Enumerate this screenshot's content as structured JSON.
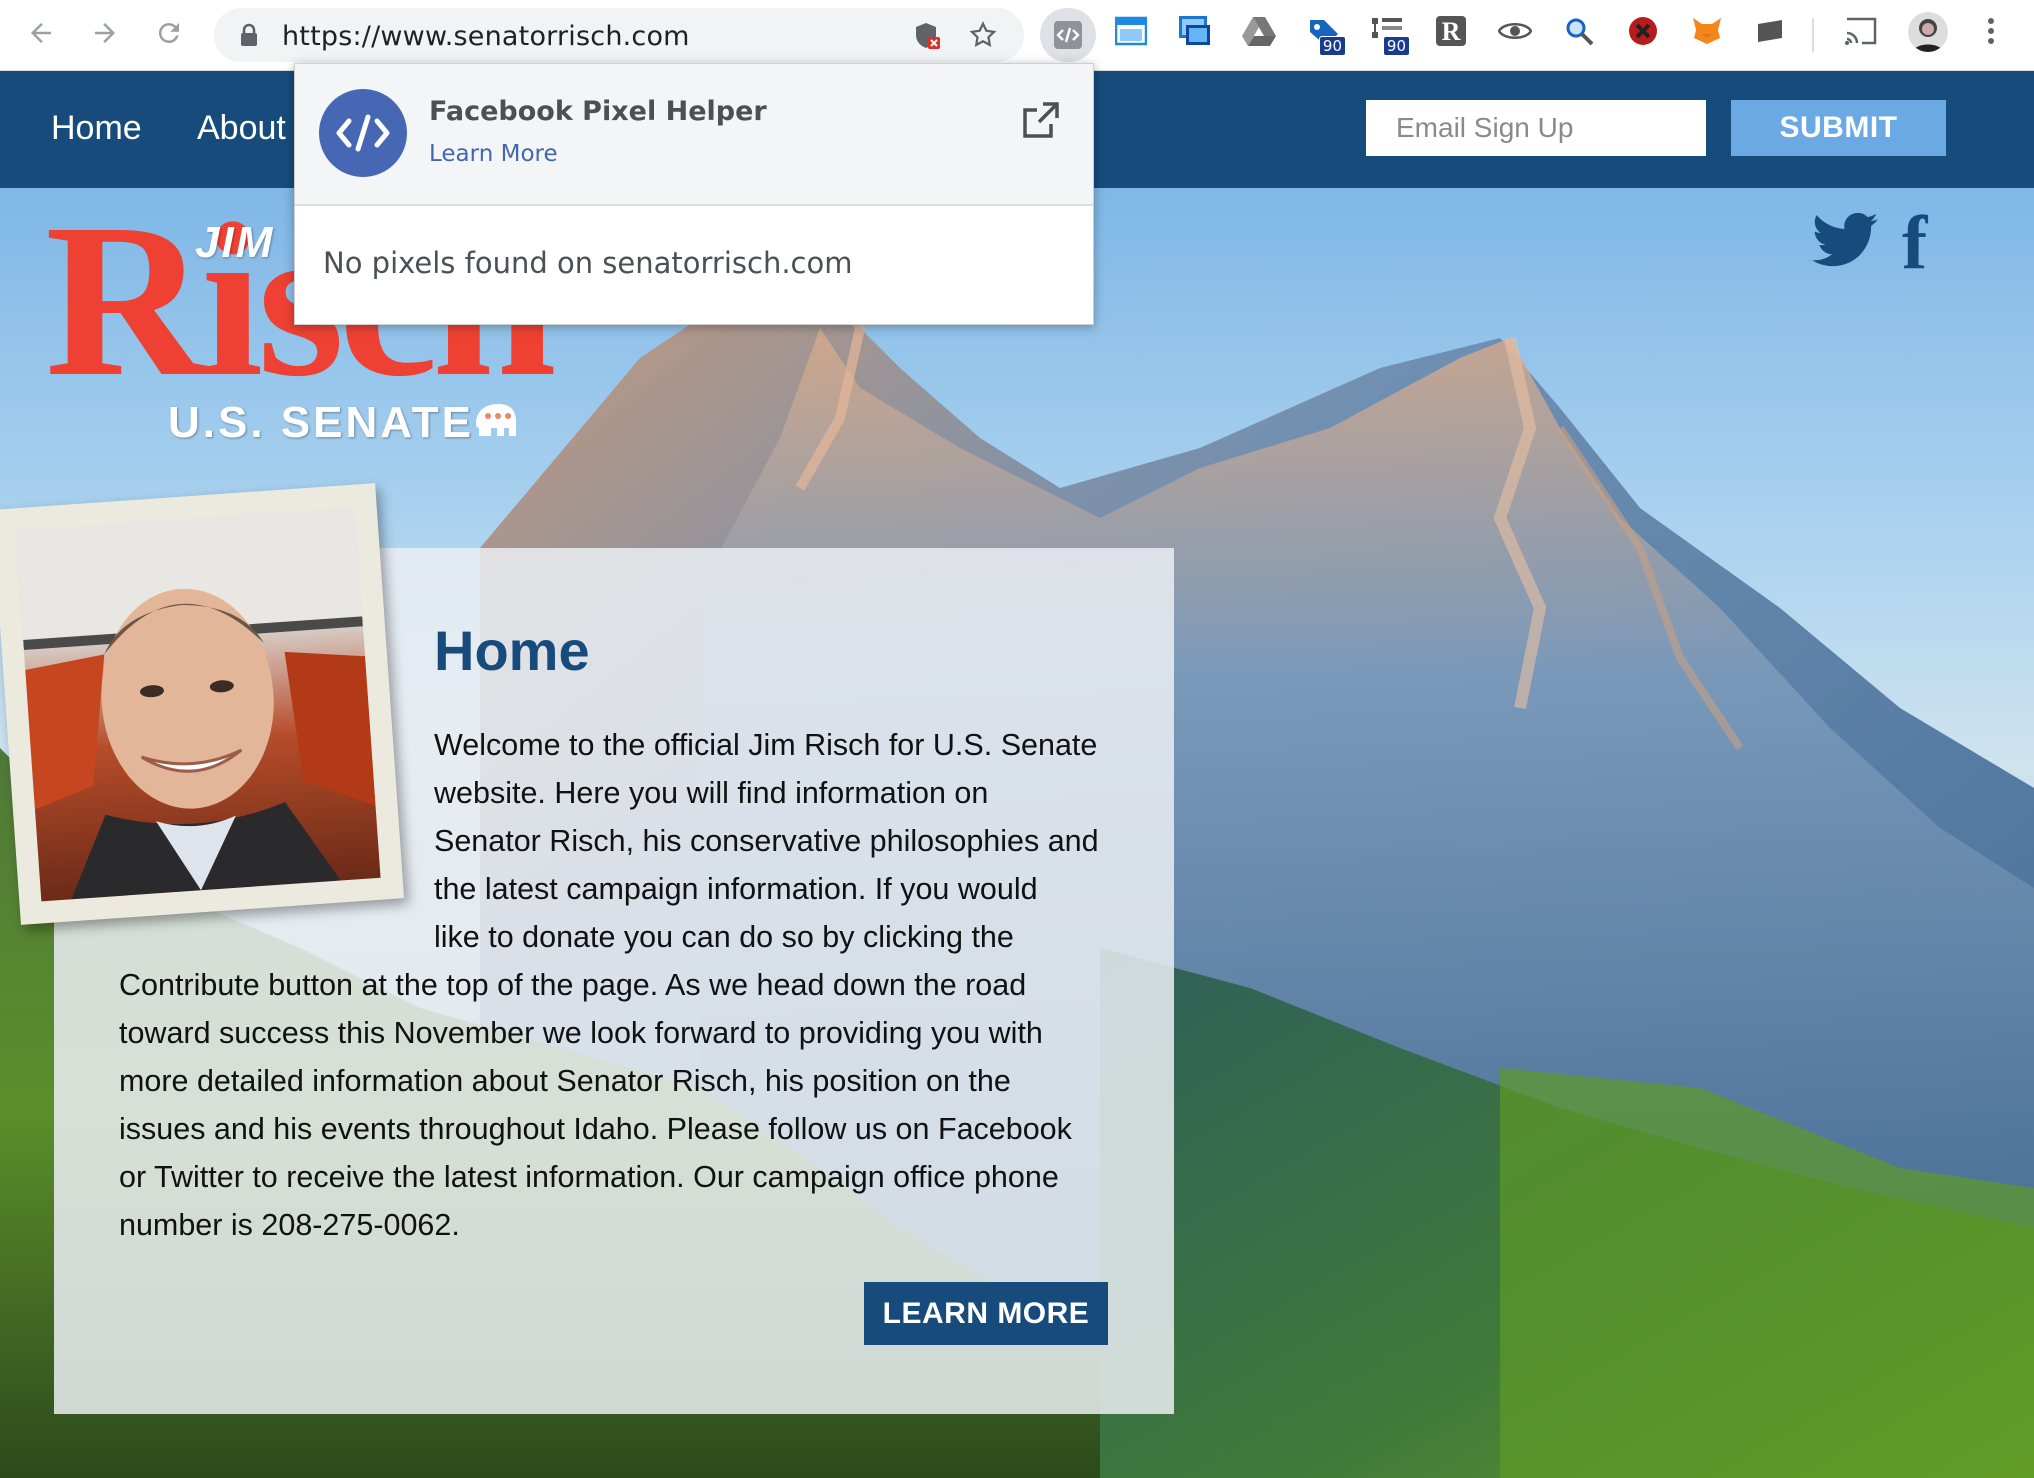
{
  "browser": {
    "url": "https://www.senatorrisch.com",
    "extensions": [
      {
        "name": "facebook-pixel-helper-icon"
      },
      {
        "name": "window-extension-icon"
      },
      {
        "name": "screenshot-extension-icon"
      },
      {
        "name": "drive-extension-icon"
      },
      {
        "name": "tag-extension-icon",
        "badge": "90"
      },
      {
        "name": "tree-extension-icon",
        "badge": "90"
      },
      {
        "name": "r-extension-icon"
      },
      {
        "name": "eye-extension-icon"
      },
      {
        "name": "magnifier-extension-icon"
      },
      {
        "name": "blocker-extension-icon"
      },
      {
        "name": "fox-extension-icon"
      },
      {
        "name": "folder-extension-icon"
      },
      {
        "name": "cast-icon"
      },
      {
        "name": "profile-avatar"
      },
      {
        "name": "menu-icon"
      }
    ]
  },
  "site_nav": {
    "home": "Home",
    "about": "About"
  },
  "signup": {
    "placeholder": "Email Sign Up",
    "submit": "SUBMIT"
  },
  "logo": {
    "jim": "JIM",
    "risch": "Risch",
    "senate": "U.S. SENATE"
  },
  "content": {
    "title": "Home",
    "lines": [
      "Welcome to the official Jim Risch for U.S. Senate",
      "website. Here you will find information on",
      "Senator Risch, his conservative philosophies and",
      "the latest campaign information. If you would",
      "like to donate you can do so by clicking the",
      "Contribute button at the top of the page. As we head down the road",
      "toward success this November we look forward to providing you with",
      "more detailed information about Senator Risch, his position on the",
      "issues and his events throughout Idaho. Please follow us on Facebook",
      "or Twitter to receive the latest information. Our campaign office phone",
      "number is 208-275-0062."
    ],
    "button": "LEARN MORE"
  },
  "popup": {
    "title": "Facebook Pixel Helper",
    "learn_more": "Learn More",
    "message": "No pixels found on senatorrisch.com"
  },
  "colors": {
    "nav_bg": "#174b7c",
    "submit_bg": "#6aa9e3",
    "logo_red": "#ee4133",
    "pixel_helper_blue": "#4667b4"
  }
}
